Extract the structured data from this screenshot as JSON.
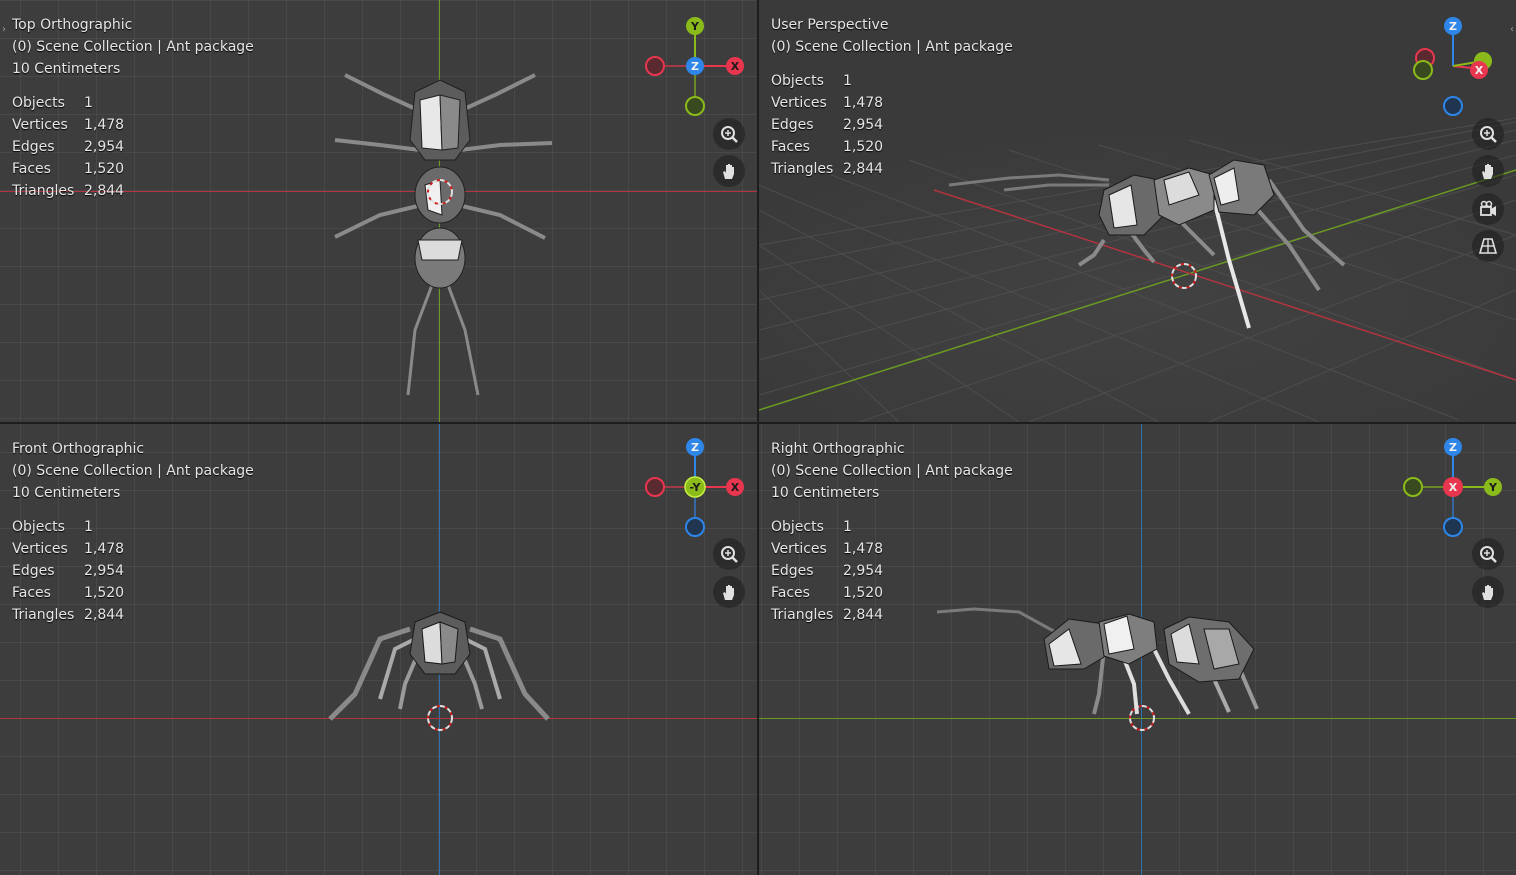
{
  "viewports": {
    "top": {
      "title": "Top Orthographic",
      "collection": "(0) Scene Collection | Ant package",
      "scale": "10 Centimeters"
    },
    "user": {
      "title": "User Perspective",
      "collection": "(0) Scene Collection | Ant package"
    },
    "front": {
      "title": "Front Orthographic",
      "collection": "(0) Scene Collection | Ant package",
      "scale": "10 Centimeters"
    },
    "right": {
      "title": "Right Orthographic",
      "collection": "(0) Scene Collection | Ant package",
      "scale": "10 Centimeters"
    }
  },
  "stats": {
    "objects_label": "Objects",
    "objects": "1",
    "vertices_label": "Vertices",
    "vertices": "1,478",
    "edges_label": "Edges",
    "edges": "2,954",
    "faces_label": "Faces",
    "faces": "1,520",
    "triangles_label": "Triangles",
    "triangles": "2,844"
  },
  "gizmo": {
    "x": "X",
    "y": "Y",
    "z": "Z",
    "neg_y": "-Y",
    "colors": {
      "x": "#e8364f",
      "y": "#8bbb1a",
      "z": "#2d86e8"
    }
  },
  "icons": {
    "zoom": "zoom-icon",
    "pan": "hand-pan-icon",
    "camera": "camera-view-icon",
    "grid": "perspective-grid-icon"
  },
  "colors": {
    "x_axis": "#b3343f",
    "y_axis": "#6a9a22",
    "z_axis": "#2f6fb0"
  }
}
